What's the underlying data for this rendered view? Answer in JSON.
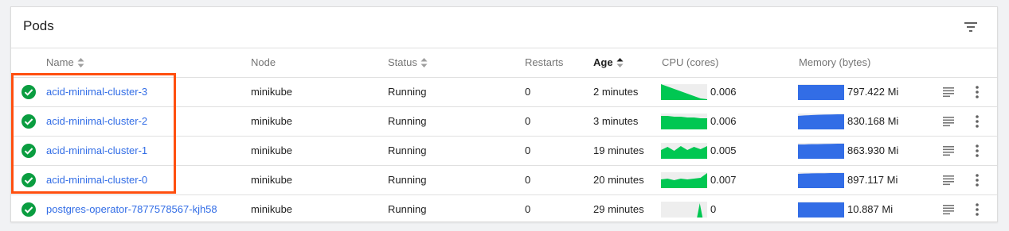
{
  "card": {
    "title": "Pods"
  },
  "columns": {
    "name": "Name",
    "node": "Node",
    "status": "Status",
    "restarts": "Restarts",
    "age": "Age",
    "cpu": "CPU (cores)",
    "memory": "Memory (bytes)"
  },
  "icons": {
    "filter": "filter-list-icon",
    "status": "check-circle-icon",
    "logs": "logs-icon",
    "menu": "more-vert-icon"
  },
  "colors": {
    "running": "#0a9d40",
    "link": "#326de6",
    "cpu_spark": "#00c752",
    "memory_spark": "#326de6",
    "highlight": "#ff4f0f"
  },
  "rows": [
    {
      "name": "acid-minimal-cluster-3",
      "node": "minikube",
      "status": "Running",
      "restarts": "0",
      "age": "2 minutes",
      "cpu": "0.006",
      "memory": "797.422 Mi"
    },
    {
      "name": "acid-minimal-cluster-2",
      "node": "minikube",
      "status": "Running",
      "restarts": "0",
      "age": "3 minutes",
      "cpu": "0.006",
      "memory": "830.168 Mi"
    },
    {
      "name": "acid-minimal-cluster-1",
      "node": "minikube",
      "status": "Running",
      "restarts": "0",
      "age": "19 minutes",
      "cpu": "0.005",
      "memory": "863.930 Mi"
    },
    {
      "name": "acid-minimal-cluster-0",
      "node": "minikube",
      "status": "Running",
      "restarts": "0",
      "age": "20 minutes",
      "cpu": "0.007",
      "memory": "897.117 Mi"
    },
    {
      "name": "postgres-operator-7877578567-kjh58",
      "node": "minikube",
      "status": "Running",
      "restarts": "0",
      "age": "29 minutes",
      "cpu": "0",
      "memory": "10.887 Mi"
    }
  ]
}
